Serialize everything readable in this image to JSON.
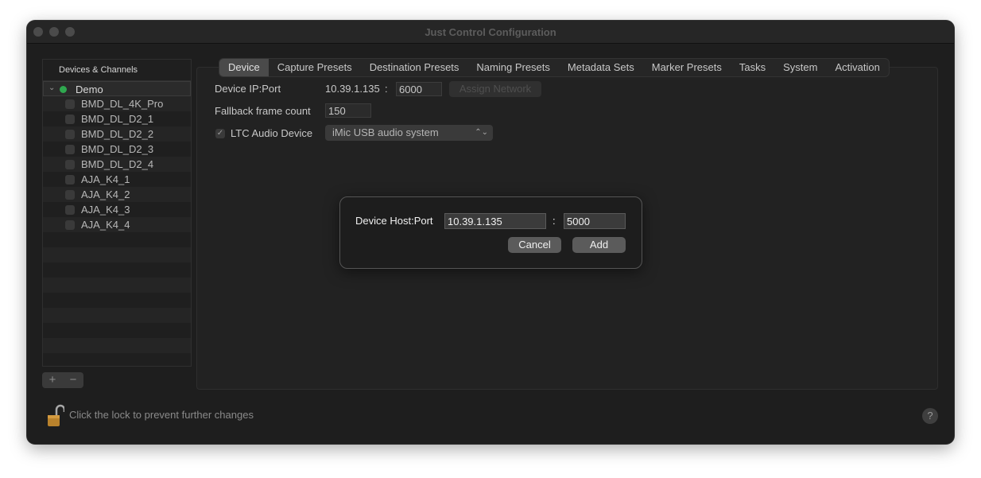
{
  "window": {
    "title": "Just Control Configuration"
  },
  "sidebar": {
    "header": "Devices & Channels",
    "root": {
      "label": "Demo",
      "status_color": "#2fa84f"
    },
    "channels": [
      "BMD_DL_4K_Pro",
      "BMD_DL_D2_1",
      "BMD_DL_D2_2",
      "BMD_DL_D2_3",
      "BMD_DL_D2_4",
      "AJA_K4_1",
      "AJA_K4_2",
      "AJA_K4_3",
      "AJA_K4_4"
    ],
    "add_label": "+",
    "remove_label": "−"
  },
  "tabs": [
    "Device",
    "Capture Presets",
    "Destination Presets",
    "Naming Presets",
    "Metadata Sets",
    "Marker Presets",
    "Tasks",
    "System",
    "Activation"
  ],
  "active_tab": "Device",
  "device": {
    "ip_label": "Device IP:Port",
    "ip_value": "10.39.1.135",
    "ip_separator": ":",
    "port_value": "6000",
    "assign_button": "Assign Network",
    "fallback_label": "Fallback frame count",
    "fallback_value": "150",
    "ltc_checkbox_label": "LTC Audio Device",
    "ltc_checked": true,
    "ltc_device": "iMic USB audio system"
  },
  "dialog": {
    "label": "Device Host:Port",
    "host_value": "10.39.1.135",
    "separator": ":",
    "port_value": "5000",
    "cancel": "Cancel",
    "add": "Add"
  },
  "footer": {
    "lock_text": "Click the lock to prevent further changes",
    "help": "?"
  },
  "icons": [
    "lock-icon",
    "help-icon",
    "chevron-down-icon",
    "checkmark-icon",
    "popup-arrows-icon"
  ]
}
